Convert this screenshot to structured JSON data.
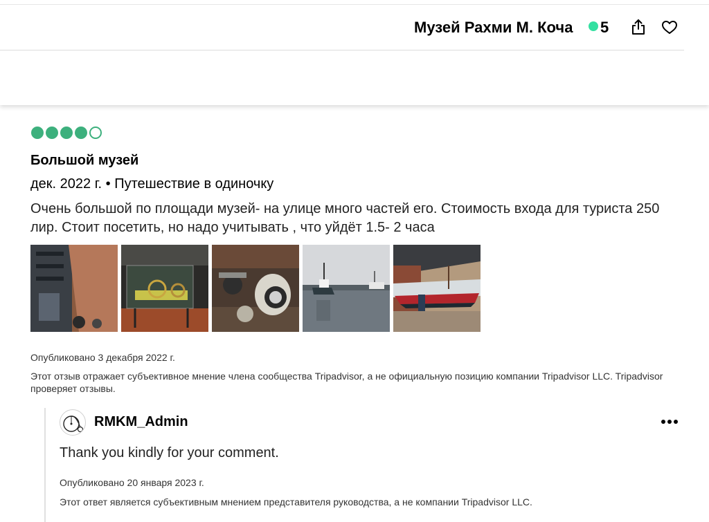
{
  "header": {
    "title": "Музей Рахми М. Коча",
    "rating": "5",
    "rating_color": "#34e0a1",
    "share_icon": "share-icon",
    "save_icon": "heart-icon"
  },
  "review": {
    "bubble_rating": 4,
    "bubble_max": 5,
    "bubble_color": "#3db07d",
    "title": "Большой музей",
    "meta": "дек. 2022 г. • Путешествие в одиночку",
    "body": "Очень большой по площади музей- на улице много частей его. Стоимость входа для туриста 250 лир. Стоит посетить, но надо учитывать , что уйдёт 1.5- 2 часа",
    "photo_count": 5,
    "published": "Опубликовано 3 декабря 2022 г.",
    "disclaimer": "Этот отзыв отражает субъективное мнение члена сообщества Tripadvisor, а не официальную позицию компании Tripadvisor LLC. Tripadvisor проверяет отзывы."
  },
  "response": {
    "name": "RMKM_Admin",
    "avatar_icon": "penny-farthing-bicycle-icon",
    "more_icon": "more-options-icon",
    "text": "Thank you kindly for your comment.",
    "published": "Опубликовано 20 января 2023 г.",
    "disclaimer": "Этот ответ является субъективным мнением представителя руководства, а не компании Tripadvisor LLC."
  }
}
